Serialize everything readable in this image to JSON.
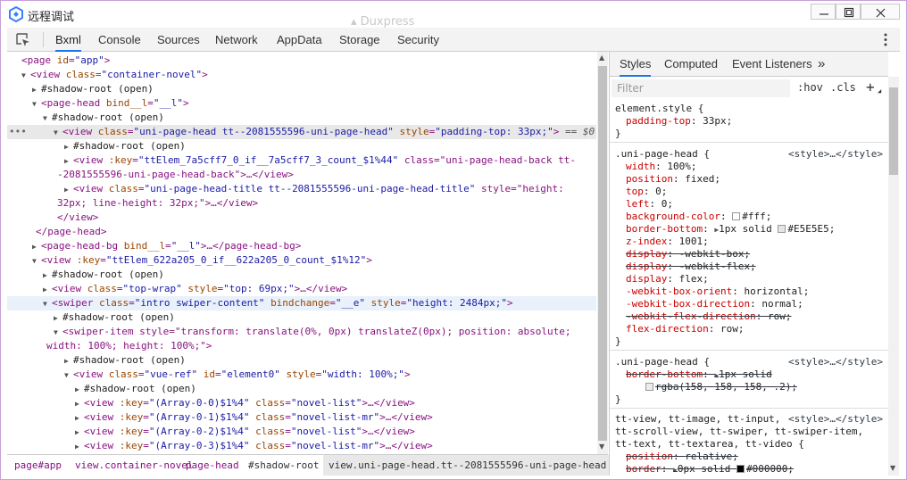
{
  "window": {
    "title": "远程调试",
    "ghost_title": "▴ Duxpress"
  },
  "toolbar": {
    "tabs": [
      "Bxml",
      "Console",
      "Sources",
      "Network",
      "AppData",
      "Storage",
      "Security"
    ],
    "active_tab": "Bxml"
  },
  "elements": {
    "lines": [
      [
        "",
        "<page id=\"app\">"
      ],
      [
        "down",
        "<view class=\"container-novel\">"
      ],
      [
        "right",
        "#shadow-root (open)"
      ],
      [
        "down",
        "<page-head bind__l=\"__l\">"
      ],
      [
        "down",
        "#shadow-root (open)"
      ],
      [
        "down",
        "<view class=\"uni-page-head tt--2081555596-uni-page-head\" style=\"padding-top: 33px;\"> == $0"
      ],
      [
        "right",
        "#shadow-root (open)"
      ],
      [
        "right",
        "<view :key=\"ttElem_7a5cff7_0_if__7a5cff7_3_count_$1%44\" class=\"uni-page-head-back tt-"
      ],
      [
        "",
        "-2081555596-uni-page-head-back\">…</view>"
      ],
      [
        "right",
        "<view class=\"uni-page-head-title tt--2081555596-uni-page-head-title\" style=\"height:"
      ],
      [
        "",
        "32px; line-height: 32px;\">…</view>"
      ],
      [
        "",
        "</view>"
      ],
      [
        "",
        "</page-head>"
      ],
      [
        "right",
        "<page-head-bg bind__l=\"__l\">…</page-head-bg>"
      ],
      [
        "down",
        "<view :key=\"ttElem_622a205_0_if__622a205_0_count_$1%12\">"
      ],
      [
        "right",
        "#shadow-root (open)"
      ],
      [
        "right",
        "<view class=\"top-wrap\" style=\"top: 69px;\">…</view>"
      ],
      [
        "down",
        "<swiper class=\"intro swiper-content\" bindchange=\"__e\" style=\"height: 2484px;\">"
      ],
      [
        "right",
        "#shadow-root (open)"
      ],
      [
        "down",
        "<swiper-item style=\"transform: translate(0%, 0px) translateZ(0px); position: absolute;"
      ],
      [
        "",
        "width: 100%; height: 100%;\">"
      ],
      [
        "right",
        "#shadow-root (open)"
      ],
      [
        "down",
        "<view class=\"vue-ref\" id=\"element0\" style=\"width: 100%;\">"
      ],
      [
        "right",
        "#shadow-root (open)"
      ],
      [
        "right",
        "<view :key=\"(Array-0-0)$1%4\" class=\"novel-list\">…</view>"
      ],
      [
        "right",
        "<view :key=\"(Array-0-1)$1%4\" class=\"novel-list-mr\">…</view>"
      ],
      [
        "right",
        "<view :key=\"(Array-0-2)$1%4\" class=\"novel-list\">…</view>"
      ],
      [
        "right",
        "<view :key=\"(Array-0-3)$1%4\" class=\"novel-list-mr\">…</view>"
      ]
    ],
    "selected_dots": "•••"
  },
  "breadcrumbs": [
    "page#app",
    "view.container-novel",
    "page-head",
    "#shadow-root",
    "view.uni-page-head.tt--2081555596-uni-page-head"
  ],
  "styles_panel": {
    "tabs": [
      "Styles",
      "Computed",
      "Event Listeners"
    ],
    "more": "»",
    "filter_placeholder": "Filter",
    "hov": ":hov",
    "cls": ".cls",
    "plus": "+",
    "rules": [
      {
        "selector": "element.style {",
        "source": "",
        "props": [
          {
            "name": "padding-top",
            "value": "33px;",
            "strike": false,
            "swatch": ""
          }
        ]
      },
      {
        "selector": ".uni-page-head {",
        "source": "<style>…</style>",
        "props": [
          {
            "name": "width",
            "value": "100%;",
            "strike": false,
            "swatch": ""
          },
          {
            "name": "position",
            "value": "fixed;",
            "strike": false,
            "swatch": ""
          },
          {
            "name": "top",
            "value": "0;",
            "strike": false,
            "swatch": ""
          },
          {
            "name": "left",
            "value": "0;",
            "strike": false,
            "swatch": ""
          },
          {
            "name": "background-color",
            "value": "#fff;",
            "strike": false,
            "swatch": "#ffffff"
          },
          {
            "name": "border-bottom",
            "value": "1px solid #E5E5E5;",
            "strike": false,
            "swatch": "#E5E5E5",
            "expand": true
          },
          {
            "name": "z-index",
            "value": "1001;",
            "strike": false,
            "swatch": ""
          },
          {
            "name": "display",
            "value": "-webkit-box;",
            "strike": true,
            "swatch": ""
          },
          {
            "name": "display",
            "value": "-webkit-flex;",
            "strike": true,
            "swatch": ""
          },
          {
            "name": "display",
            "value": "flex;",
            "strike": false,
            "swatch": ""
          },
          {
            "name": "-webkit-box-orient",
            "value": "horizontal;",
            "strike": false,
            "swatch": ""
          },
          {
            "name": "-webkit-box-direction",
            "value": "normal;",
            "strike": false,
            "swatch": ""
          },
          {
            "name": "-webkit-flex-direction",
            "value": "row;",
            "strike": true,
            "swatch": ""
          },
          {
            "name": "flex-direction",
            "value": "row;",
            "strike": false,
            "swatch": ""
          }
        ]
      },
      {
        "selector": ".uni-page-head {",
        "source": "<style>…</style>",
        "props": [
          {
            "name": "border-bottom",
            "value": "1px solid",
            "strike": true,
            "swatch": "",
            "expand": true
          },
          {
            "name": "",
            "value": "rgba(158, 158, 158, .2);",
            "strike": true,
            "swatch": "rgba(158,158,158,0.2)"
          }
        ]
      },
      {
        "selector_lines": [
          "tt-view, tt-image, tt-input,",
          "tt-scroll-view, tt-swiper, tt-swiper-item,",
          "tt-text, tt-textarea, tt-video {"
        ],
        "source": "<style>…</style>",
        "props": [
          {
            "name": "position",
            "value": "relative;",
            "strike": true,
            "swatch": ""
          },
          {
            "name": "border",
            "value": "0px solid #000000;",
            "strike": true,
            "swatch": "#000000",
            "expand": true
          }
        ]
      }
    ]
  },
  "colors": {
    "accent": "#1a73e8",
    "tag": "#881280",
    "attr": "#994500",
    "value": "#1a1aa6",
    "prop": "#c80000"
  }
}
